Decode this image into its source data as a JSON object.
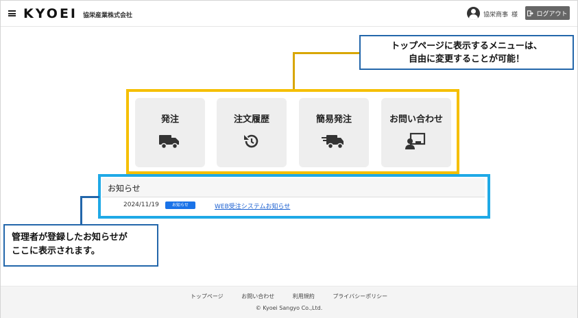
{
  "header": {
    "logo": "KYOEI",
    "company": "協栄産業株式会社",
    "user_name": "協栄商事",
    "user_suffix": "様",
    "logout_label": "ログアウト"
  },
  "callouts": {
    "top_line1": "トップページに表示するメニューは、",
    "top_line2": "自由に変更することが可能！",
    "bottom_line1": "管理者が登録したお知らせが",
    "bottom_line2": "ここに表示されます。"
  },
  "menu": [
    {
      "label": "発注",
      "icon": "truck-icon"
    },
    {
      "label": "注文履歴",
      "icon": "history-icon"
    },
    {
      "label": "簡易発注",
      "icon": "fast-truck-icon"
    },
    {
      "label": "お問い合わせ",
      "icon": "support-icon"
    }
  ],
  "notice": {
    "title": "お知らせ",
    "items": [
      {
        "date": "2024/11/19",
        "badge": "お知らせ",
        "link": "WEB受注システムお知らせ"
      }
    ]
  },
  "footer": {
    "links": [
      "トップページ",
      "お問い合わせ",
      "利用規約",
      "プライバシーポリシー"
    ],
    "copyright": "© Kyoei Sangyo Co.,Ltd."
  },
  "colors": {
    "menu_frame": "#f5bf00",
    "notice_frame": "#1fa9e6",
    "callout_border": "#2266aa",
    "badge": "#1a73e8"
  }
}
